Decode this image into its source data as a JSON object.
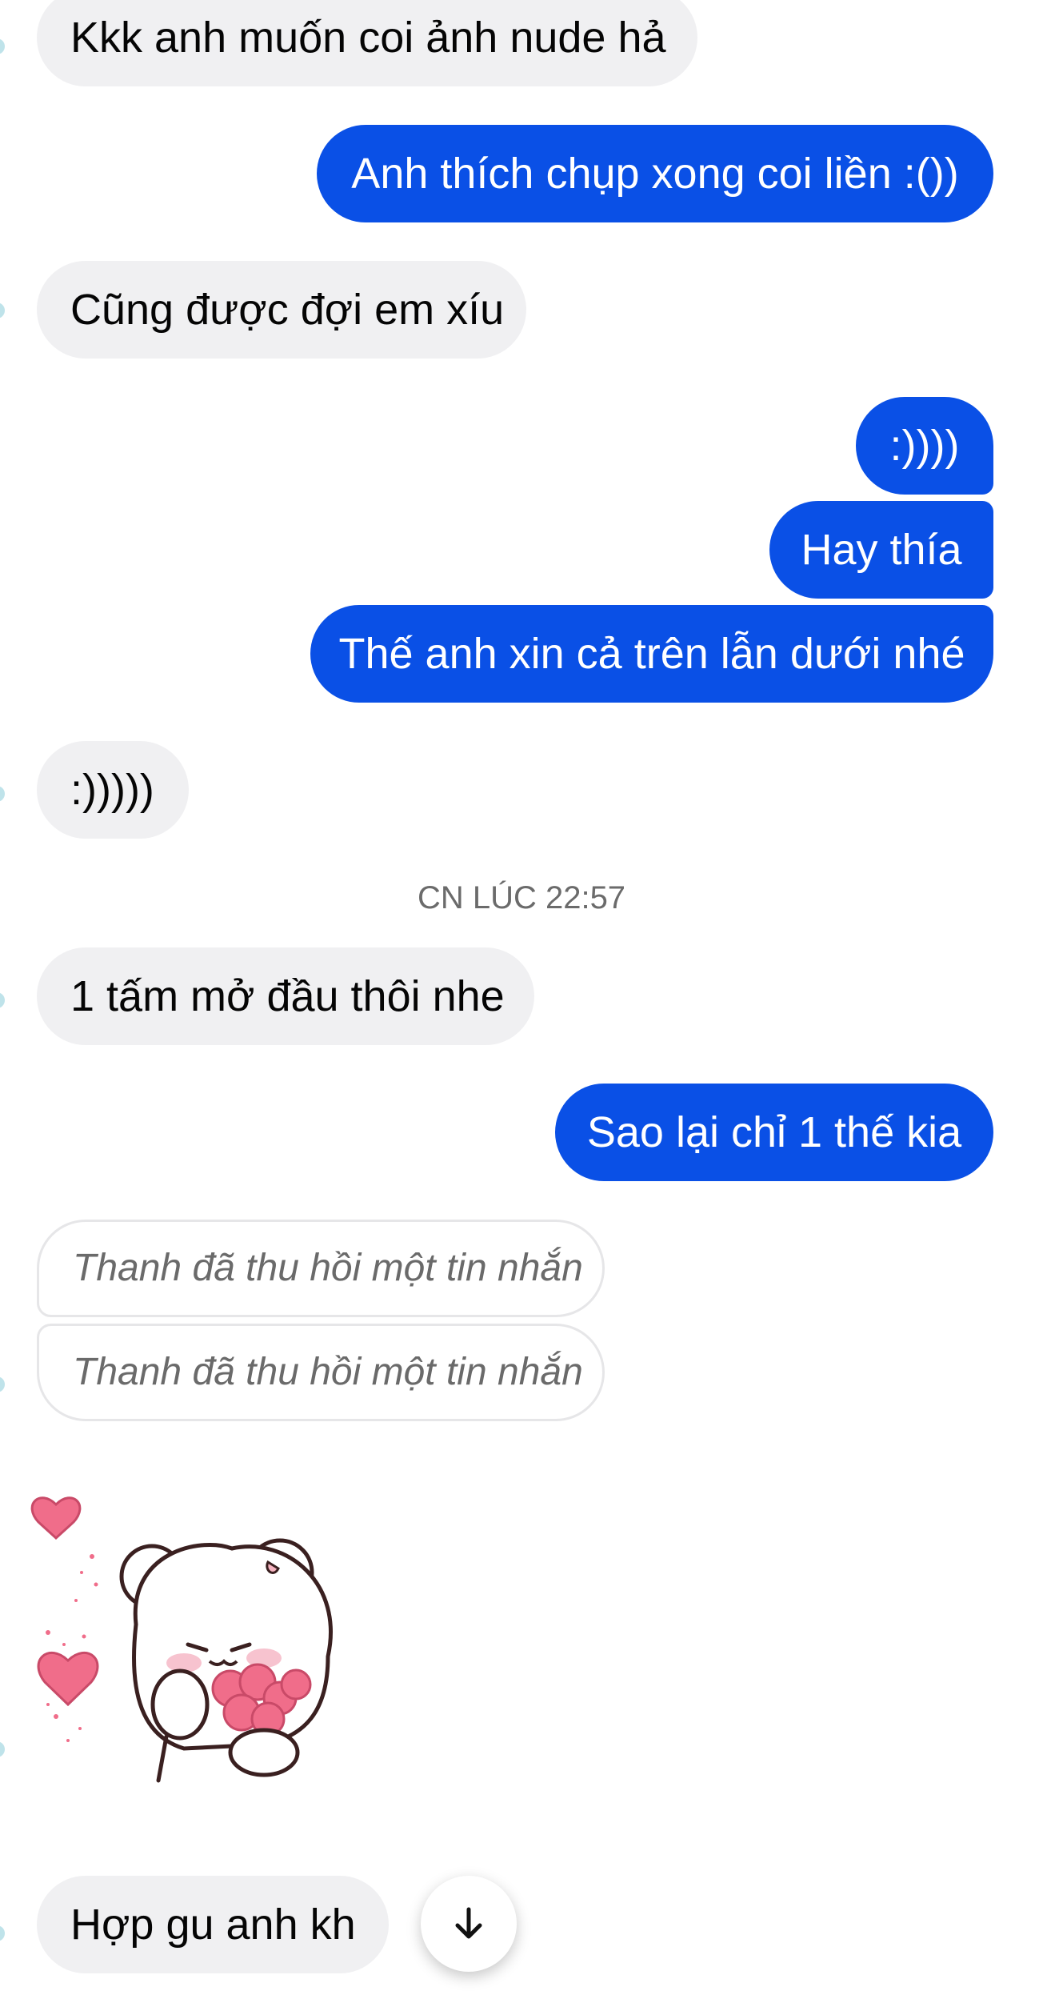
{
  "messages": {
    "m1": "Kkk anh muốn coi ảnh nude hả",
    "m2": "Anh thích chụp xong coi liền :())",
    "m3": "Cũng được đợi em xíu",
    "m4": ":))))",
    "m5": "Hay thía",
    "m6": "Thế anh xin cả trên lẫn dưới nhé",
    "m7": ":)))))",
    "m8": "1 tấm mở đầu thôi nhe",
    "m9": "Sao lại chỉ 1 thế kia",
    "m10": "Thanh đã thu hồi một tin nhắn",
    "m11": "Thanh đã thu hồi một tin nhắn",
    "m12": "Hợp gu anh kh"
  },
  "timestamp": "CN LÚC 22:57",
  "sticker": {
    "icon": "bear-with-hearts-sticker"
  },
  "scroll_button": {
    "icon": "arrow-down-icon"
  },
  "colors": {
    "outgoing_bubble": "#0a50e6",
    "incoming_bubble": "#f0f0f2",
    "heart": "#f06d8a"
  }
}
